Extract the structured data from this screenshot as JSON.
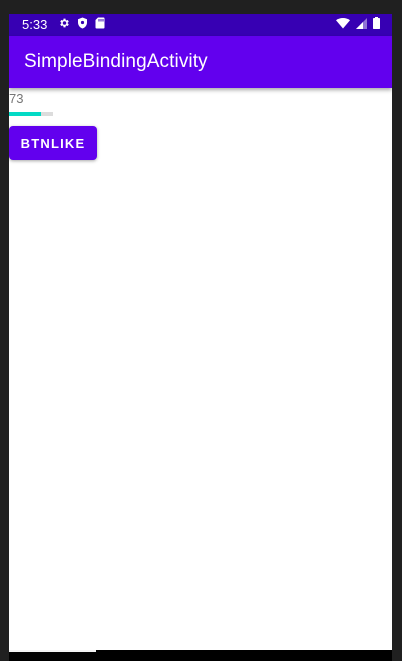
{
  "status_bar": {
    "time": "5:33",
    "left_icons": [
      "gear-icon",
      "shield-icon",
      "sd-card-icon"
    ],
    "right_icons": [
      "wifi-icon",
      "signal-icon",
      "battery-icon"
    ],
    "bg_color": "#3700b3"
  },
  "app_bar": {
    "title": "SimpleBindingActivity",
    "bg_color": "#6200ee"
  },
  "main": {
    "count_text": "73",
    "progress": {
      "value": 73,
      "max": 100,
      "fill_color": "#03dac5"
    },
    "like_button_label": "BTNLIKE"
  }
}
